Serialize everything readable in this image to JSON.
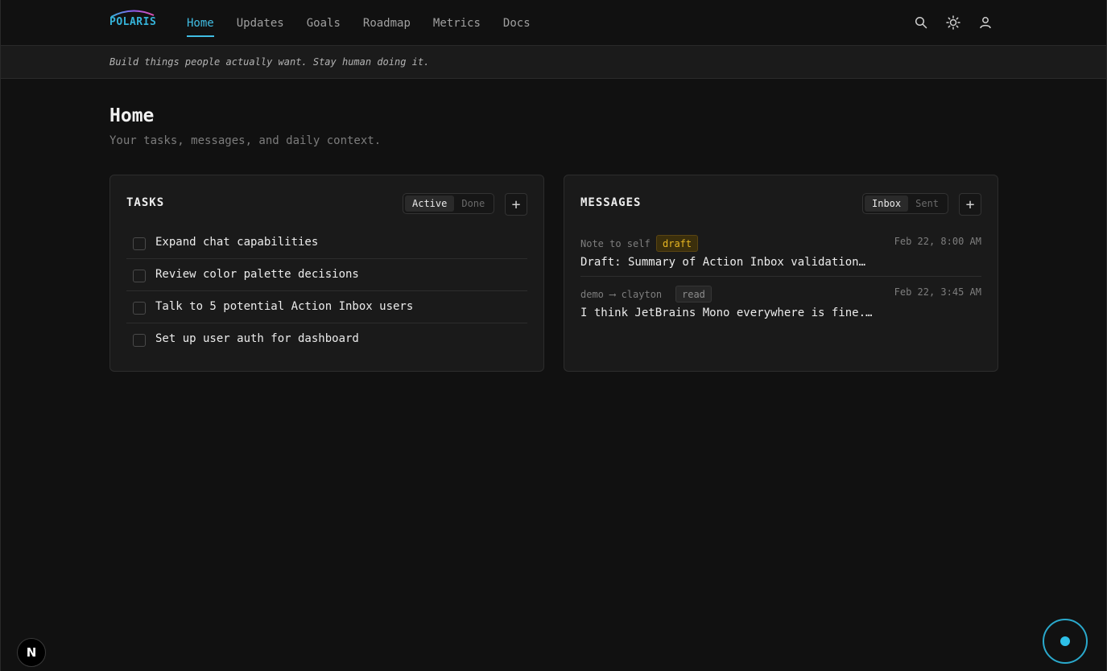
{
  "app": {
    "logo_text": "POLARIS",
    "accent_color": "#41bde3"
  },
  "nav": {
    "items": [
      {
        "label": "Home",
        "active": true
      },
      {
        "label": "Updates",
        "active": false
      },
      {
        "label": "Goals",
        "active": false
      },
      {
        "label": "Roadmap",
        "active": false
      },
      {
        "label": "Metrics",
        "active": false
      },
      {
        "label": "Docs",
        "active": false
      }
    ],
    "icons": [
      "search-icon",
      "sun-icon",
      "user-icon"
    ]
  },
  "tagline": "Build things people actually want. Stay human doing it.",
  "page": {
    "title": "Home",
    "subtitle": "Your tasks, messages, and daily context."
  },
  "tasks": {
    "title": "TASKS",
    "filters": [
      "Active",
      "Done"
    ],
    "selected_filter": "Active",
    "add_label": "+",
    "items": [
      "Expand chat capabilities",
      "Review color palette decisions",
      "Talk to 5 potential Action Inbox users",
      "Set up user auth for dashboard"
    ]
  },
  "messages": {
    "title": "MESSAGES",
    "filters": [
      "Inbox",
      "Sent"
    ],
    "selected_filter": "Inbox",
    "add_label": "+",
    "items": [
      {
        "from": "Note to self",
        "badge": "draft",
        "time": "Feb 22, 8:00 AM",
        "subject": "Draft: Summary of Action Inbox validation…"
      },
      {
        "from": "demo ⟶ clayton",
        "badge": "read",
        "time": "Feb 22, 3:45 AM",
        "subject": "I think JetBrains Mono everywhere is fine.…"
      }
    ]
  },
  "floating": {
    "next_badge": "N"
  }
}
